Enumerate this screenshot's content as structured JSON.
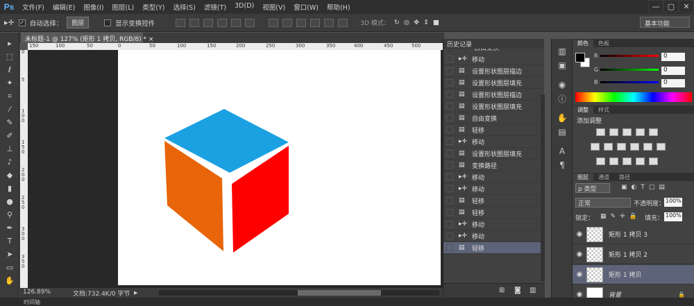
{
  "app": {
    "logo": "Ps"
  },
  "menubar": [
    "文件(F)",
    "编辑(E)",
    "图像(I)",
    "图层(L)",
    "类型(Y)",
    "选择(S)",
    "滤镜(T)",
    "3D(D)",
    "视图(V)",
    "窗口(W)",
    "帮助(H)"
  ],
  "window_controls": {
    "minimize": "—",
    "maximize": "▢",
    "close": "✕"
  },
  "options": {
    "auto_select_label": "自动选择：",
    "auto_select_value": "图层",
    "show_transform_label": "显示变换控件",
    "mode3d_label": "3D 模式：",
    "workspace": "基本功能"
  },
  "document": {
    "tab_title": "未标题-1 @ 127% (矩形 1 拷贝, RGB/8) * ×",
    "zoom": "126.89%",
    "doc_info": "文档:732.4K/0 字节"
  },
  "ruler": {
    "h_ticks": [
      "150",
      "100",
      "50",
      "0",
      "50",
      "100",
      "150",
      "200",
      "250",
      "300",
      "350",
      "400",
      "450",
      "500"
    ],
    "v_ticks": [
      "0",
      "5",
      "1 0 0",
      "1 5 0",
      "2 0 0",
      "2 5 0",
      "3 0 0",
      "3 5 0"
    ]
  },
  "cube": {
    "top_color": "#1ba1e2",
    "left_color": "#e8650a",
    "right_color": "#ff0000"
  },
  "history": {
    "title": "历史记录",
    "partial_first": "自由变换",
    "items": [
      {
        "icon": "move",
        "label": "移动"
      },
      {
        "icon": "doc",
        "label": "设置形状图层描边"
      },
      {
        "icon": "doc",
        "label": "设置形状图层填充"
      },
      {
        "icon": "doc",
        "label": "设置形状图层描边"
      },
      {
        "icon": "doc",
        "label": "设置形状图层填充"
      },
      {
        "icon": "doc",
        "label": "自由变换"
      },
      {
        "icon": "doc",
        "label": "轻移"
      },
      {
        "icon": "move",
        "label": "移动"
      },
      {
        "icon": "doc",
        "label": "设置形状图层填充"
      },
      {
        "icon": "doc",
        "label": "变换路径"
      },
      {
        "icon": "move",
        "label": "移动"
      },
      {
        "icon": "move",
        "label": "移动"
      },
      {
        "icon": "doc",
        "label": "轻移"
      },
      {
        "icon": "doc",
        "label": "轻移"
      },
      {
        "icon": "move",
        "label": "移动"
      },
      {
        "icon": "move",
        "label": "移动"
      },
      {
        "icon": "doc",
        "label": "轻移"
      }
    ],
    "selected_index": 16
  },
  "color_panel": {
    "tabs": [
      "颜色",
      "色板"
    ],
    "channels": [
      {
        "name": "R",
        "value": "0"
      },
      {
        "name": "G",
        "value": "0"
      },
      {
        "name": "B",
        "value": "0"
      }
    ]
  },
  "adjust_panel": {
    "tabs": [
      "调整",
      "样式"
    ],
    "title": "添加调整"
  },
  "layers_panel": {
    "tabs": [
      "图层",
      "通道",
      "路径"
    ],
    "filter_label": "ρ 类型",
    "blend_mode": "正常",
    "opacity_label": "不透明度：",
    "opacity": "100%",
    "lock_label": "锁定：",
    "fill_label": "填充：",
    "fill": "100%",
    "layers": [
      {
        "name": "矩形 1 拷贝 3",
        "selected": false,
        "italic": false
      },
      {
        "name": "矩形 1 拷贝 2",
        "selected": false,
        "italic": false
      },
      {
        "name": "矩形 1 拷贝",
        "selected": true,
        "italic": false
      },
      {
        "name": "背景",
        "selected": false,
        "italic": true
      }
    ]
  },
  "timeline": {
    "label": "时间轴"
  }
}
